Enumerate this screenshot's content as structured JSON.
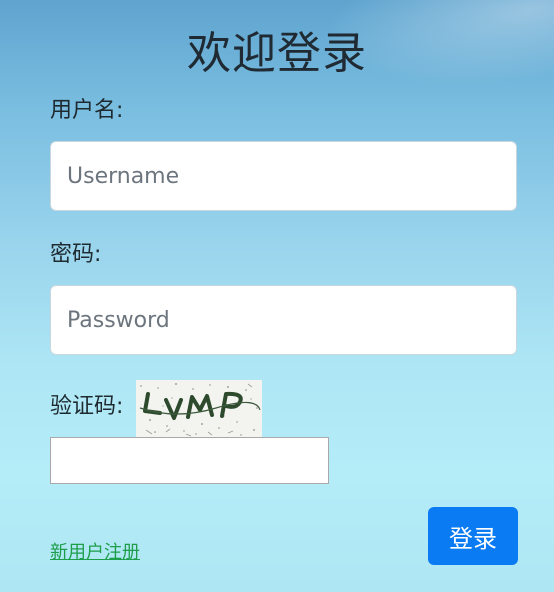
{
  "title": "欢迎登录",
  "form": {
    "username_label": "用户名:",
    "username_placeholder": "Username",
    "username_value": "",
    "password_label": "密码:",
    "password_placeholder": "Password",
    "password_value": "",
    "captcha_label": "验证码:",
    "captcha_value": ""
  },
  "captcha_image": {
    "text": "LVMP"
  },
  "register_link": "新用户注册",
  "login_button": "登录",
  "colors": {
    "button": "#0b7bf3",
    "link": "#1e9e4a",
    "title": "#1f2a33"
  }
}
